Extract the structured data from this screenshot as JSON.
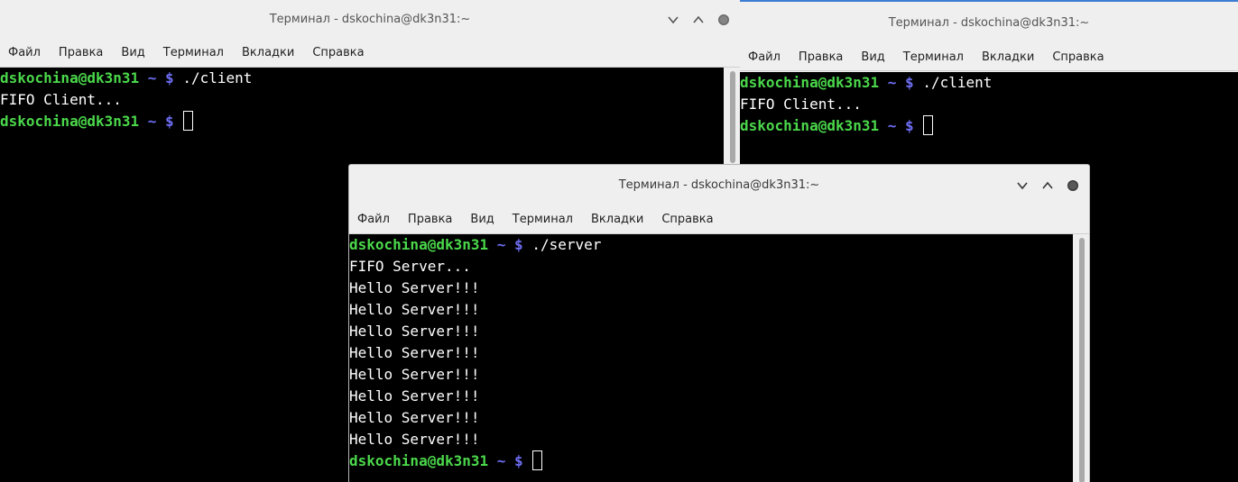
{
  "windows": [
    {
      "title": "Терминал - dskochina@dk3n31:~",
      "menu": [
        "Файл",
        "Правка",
        "Вид",
        "Терминал",
        "Вкладки",
        "Справка"
      ],
      "lines": [
        {
          "user": "dskochina@dk3n31",
          "tilde": "~",
          "dollar": "$",
          "cmd": "./client"
        },
        {
          "text": "FIFO Client..."
        },
        {
          "user": "dskochina@dk3n31",
          "tilde": "~",
          "dollar": "$",
          "cmd": "",
          "cursor": true
        }
      ]
    },
    {
      "title": "Терминал - dskochina@dk3n31:~",
      "menu": [
        "Файл",
        "Правка",
        "Вид",
        "Терминал",
        "Вкладки",
        "Справка"
      ],
      "lines": [
        {
          "user": "dskochina@dk3n31",
          "tilde": "~",
          "dollar": "$",
          "cmd": "./client"
        },
        {
          "text": "FIFO Client..."
        },
        {
          "user": "dskochina@dk3n31",
          "tilde": "~",
          "dollar": "$",
          "cmd": "",
          "cursor": true
        }
      ]
    },
    {
      "title": "Терминал - dskochina@dk3n31:~",
      "menu": [
        "Файл",
        "Правка",
        "Вид",
        "Терминал",
        "Вкладки",
        "Справка"
      ],
      "lines": [
        {
          "user": "dskochina@dk3n31",
          "tilde": "~",
          "dollar": "$",
          "cmd": "./server"
        },
        {
          "text": "FIFO Server..."
        },
        {
          "text": "Hello Server!!!"
        },
        {
          "text": "Hello Server!!!"
        },
        {
          "text": "Hello Server!!!"
        },
        {
          "text": "Hello Server!!!"
        },
        {
          "text": "Hello Server!!!"
        },
        {
          "text": "Hello Server!!!"
        },
        {
          "text": "Hello Server!!!"
        },
        {
          "text": "Hello Server!!!"
        },
        {
          "user": "dskochina@dk3n31",
          "tilde": "~",
          "dollar": "$",
          "cmd": "",
          "cursor": true
        }
      ]
    }
  ],
  "icons": {
    "minimize": "chevron-down-icon",
    "maximize": "chevron-up-icon",
    "close": "close-dot-icon"
  },
  "colors": {
    "prompt_user": "#4bd84b",
    "prompt_symbol": "#6e6ef5",
    "terminal_bg": "#000000",
    "active_border": "#3d7dd3"
  }
}
